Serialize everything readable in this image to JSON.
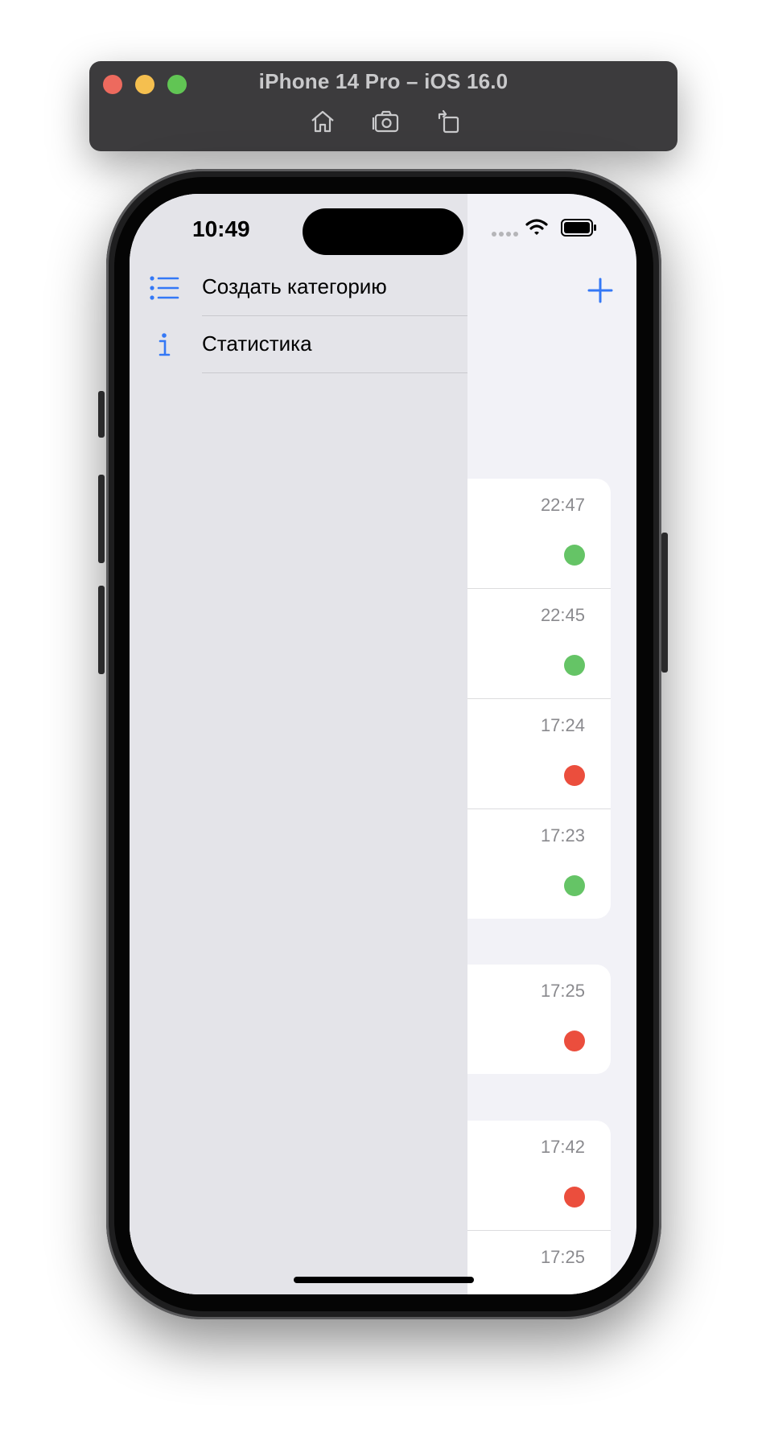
{
  "simulator": {
    "title": "iPhone 14 Pro – iOS 16.0",
    "toolbar": [
      "home-icon",
      "screenshot-icon",
      "rotate-icon"
    ]
  },
  "status_bar": {
    "time": "10:49"
  },
  "colors": {
    "accent": "#3478f6",
    "green": "#65c466",
    "red": "#eb4e3d",
    "menu_bg": "#e4e4e9",
    "list_bg": "#f2f2f7"
  },
  "menu": {
    "items": [
      {
        "label": "Создать категорию",
        "icon": "list-icon"
      },
      {
        "label": "Статистика",
        "icon": "info-icon"
      }
    ]
  },
  "list": {
    "sections": [
      {
        "rows": [
          {
            "time": "22:47",
            "status": "green"
          },
          {
            "time": "22:45",
            "status": "green"
          },
          {
            "time": "17:24",
            "status": "red"
          },
          {
            "time": "17:23",
            "status": "green"
          }
        ]
      },
      {
        "rows": [
          {
            "time": "17:25",
            "status": "red"
          }
        ]
      },
      {
        "rows": [
          {
            "time": "17:42",
            "status": "red"
          },
          {
            "time": "17:25",
            "status": ""
          }
        ]
      }
    ]
  }
}
